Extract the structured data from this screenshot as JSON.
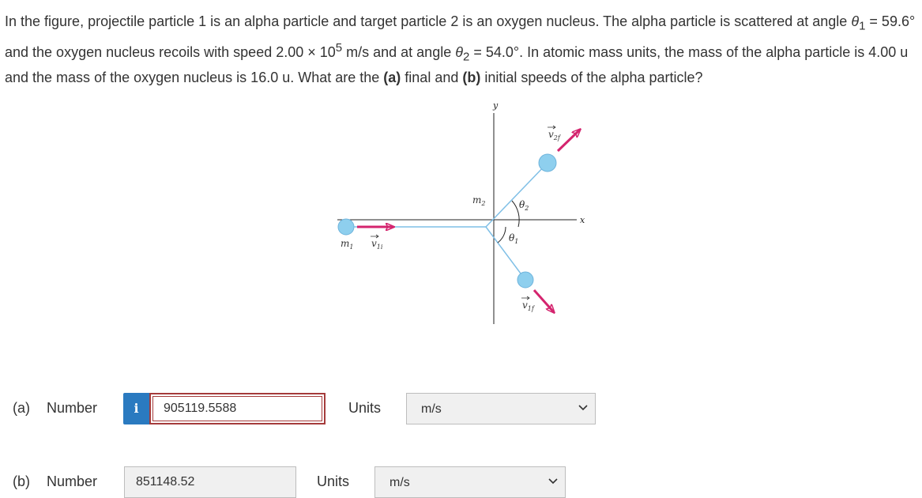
{
  "problem": {
    "p1": "In the figure, projectile particle 1 is an alpha particle and target particle 2 is an oxygen nucleus. The alpha particle is scattered at angle ",
    "theta1_sym": "θ",
    "theta1_sub": "1",
    "theta1_val": " = 59.6° and the oxygen nucleus recoils with speed 2.00 × 10",
    "exp": "5",
    "p2": " m/s and at angle ",
    "theta2_sym": "θ",
    "theta2_sub": "2",
    "p3": " = 54.0°. In atomic mass units, the mass of the alpha particle is 4.00 u and the mass of the oxygen nucleus is 16.0 u. What are the ",
    "part_a_tag": "(a)",
    "p4": " final and ",
    "part_b_tag": "(b)",
    "p5": " initial speeds of the alpha particle?"
  },
  "figure": {
    "y_axis": "y",
    "x_axis": "x",
    "m1": "m",
    "m1_sub": "1",
    "m2": "m",
    "m2_sub": "2",
    "v1i": "v",
    "v1i_sub": "1i",
    "v1f": "v",
    "v1f_sub": "1f",
    "v2f": "v",
    "v2f_sub": "2f",
    "theta1": "θ",
    "theta1_sub": "1",
    "theta2": "θ",
    "theta2_sub": "2",
    "particle_color": "#8ecfee",
    "arrow_color": "#d4246e",
    "line_color": "#7fbfe6"
  },
  "answers": {
    "a": {
      "label": "(a)",
      "number_label": "Number",
      "info_icon": "i",
      "value": "905119.5588",
      "units_label": "Units",
      "units_value": "m/s"
    },
    "b": {
      "label": "(b)",
      "number_label": "Number",
      "value": "851148.52",
      "units_label": "Units",
      "units_value": "m/s"
    }
  },
  "colors": {
    "info_button": "#2a7ac0",
    "error_border": "#a53b3b",
    "field_bg": "#f0f0f0"
  }
}
